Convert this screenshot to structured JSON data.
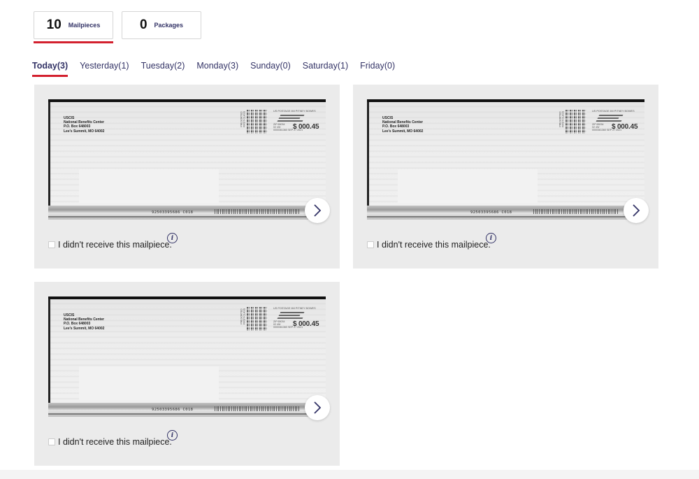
{
  "summary_tabs": {
    "mailpieces": {
      "count": "10",
      "label": "Mailpieces",
      "active": true
    },
    "packages": {
      "count": "0",
      "label": "Packages",
      "active": false
    }
  },
  "day_tabs": [
    {
      "label": "Today(3)",
      "active": true
    },
    {
      "label": "Yesterday(1)",
      "active": false
    },
    {
      "label": "Tuesday(2)",
      "active": false
    },
    {
      "label": "Monday(3)",
      "active": false
    },
    {
      "label": "Sunday(0)",
      "active": false
    },
    {
      "label": "Saturday(1)",
      "active": false
    },
    {
      "label": "Friday(0)",
      "active": false
    }
  ],
  "mailpieces": [
    {
      "return_address": [
        "USCIS",
        "National Benefits Center",
        "P.O. Box 648003",
        "Lee's Summit, MO 64002"
      ],
      "class_mark": "PRESORTED FIRST-CLASS",
      "postage_header": "US POSTAGE IMI PITNEY BOWES",
      "zip_meta": "ZIP 65034\n02 4W\n0000361360 SEP 27 2021",
      "postage_amount": "$ 000.45",
      "imb_text": "92503395686 C018",
      "not_received_label": "I didn't receive this mailpiece.",
      "checked": false
    },
    {
      "return_address": [
        "USCIS",
        "National Benefits Center",
        "P.O. Box 648003",
        "Lee's Summit, MO 64002"
      ],
      "class_mark": "PRESORTED FIRST-CLASS",
      "postage_header": "US POSTAGE IMI PITNEY BOWES",
      "zip_meta": "ZIP 65034\n02 4W\n0000361360 SEP 27 2021",
      "postage_amount": "$ 000.45",
      "imb_text": "92503395686 C018",
      "not_received_label": "I didn't receive this mailpiece.",
      "checked": false
    },
    {
      "return_address": [
        "USCIS",
        "National Benefits Center",
        "P.O. Box 648003",
        "Lee's Summit, MO 64002"
      ],
      "class_mark": "PRESORTED FIRST-CLASS",
      "postage_header": "US POSTAGE IMI PITNEY BOWES",
      "zip_meta": "ZIP 65034\n02 4W\n0000361360 SEP 27 2021",
      "postage_amount": "$ 000.45",
      "imb_text": "92503395686 C018",
      "not_received_label": "I didn't receive this mailpiece.",
      "checked": false
    }
  ],
  "icons": {
    "next": "chevron-right-icon",
    "info": "info-icon"
  },
  "colors": {
    "accent_red": "#d3202e",
    "brand_navy": "#333366",
    "card_bg": "#ebebeb"
  }
}
